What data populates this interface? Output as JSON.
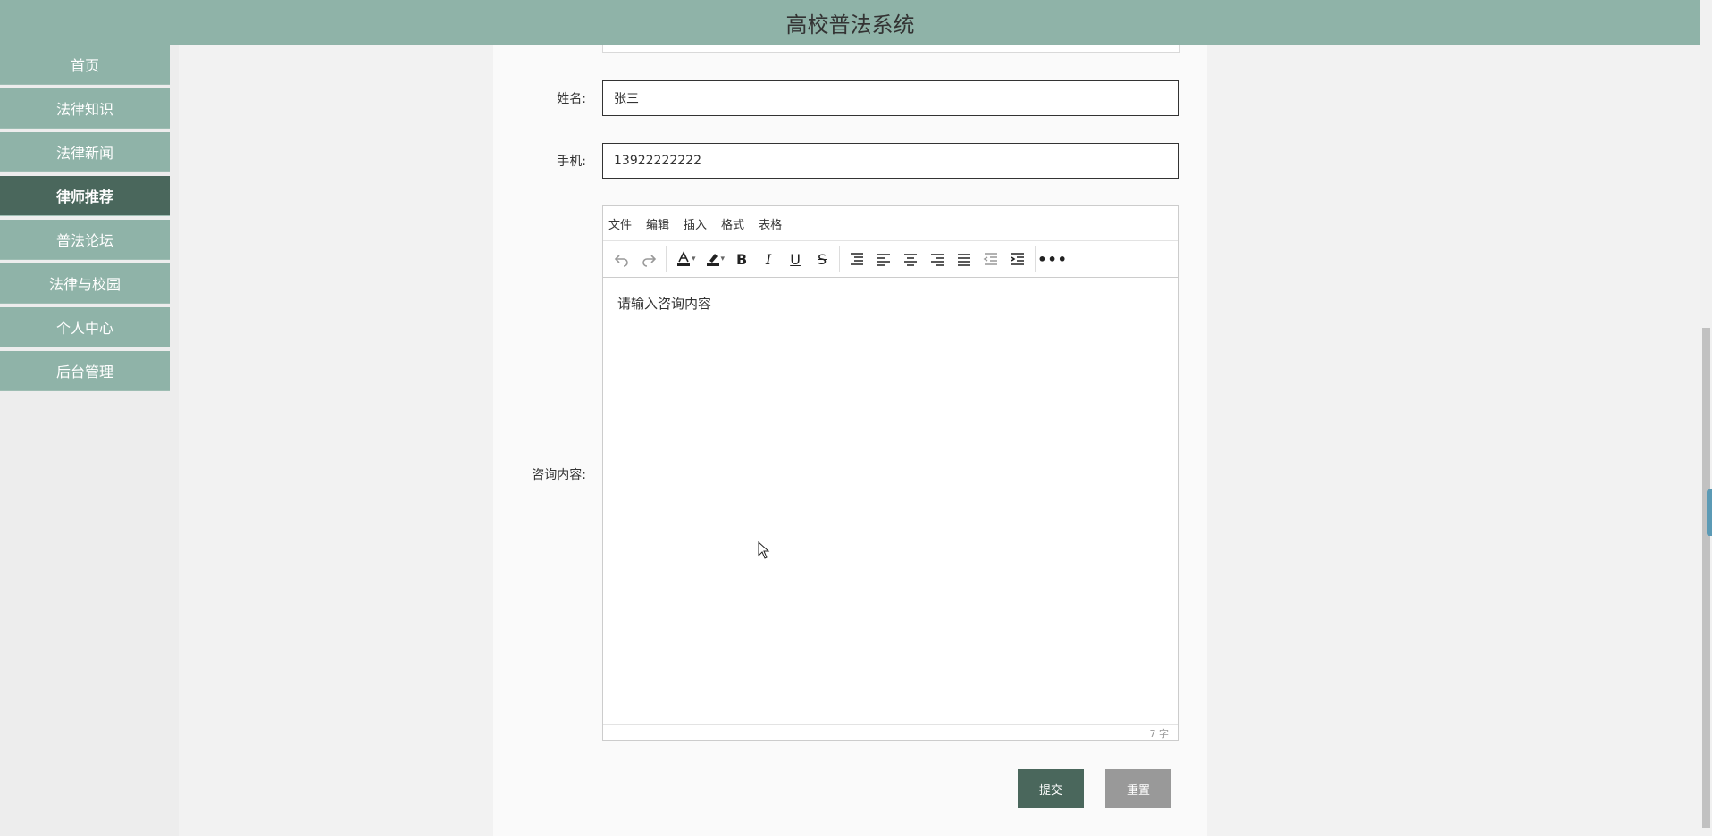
{
  "app": {
    "title": "高校普法系统"
  },
  "sidebar": {
    "items": [
      {
        "label": "首页"
      },
      {
        "label": "法律知识"
      },
      {
        "label": "法律新闻"
      },
      {
        "label": "律师推荐",
        "active": true
      },
      {
        "label": "普法论坛"
      },
      {
        "label": "法律与校园"
      },
      {
        "label": "个人中心"
      },
      {
        "label": "后台管理"
      }
    ]
  },
  "form": {
    "name_label": "姓名:",
    "name_value": "张三",
    "phone_label": "手机:",
    "phone_value": "13922222222",
    "content_label": "咨询内容:"
  },
  "editor": {
    "menu": [
      "文件",
      "编辑",
      "插入",
      "格式",
      "表格"
    ],
    "toolbar_icons": [
      "undo-icon",
      "redo-icon",
      "font-color-icon",
      "highlight-icon",
      "bold-icon",
      "italic-icon",
      "underline-icon",
      "strikethrough-icon",
      "line-height-icon",
      "align-left-icon",
      "align-center-icon",
      "align-right-icon",
      "align-justify-icon",
      "outdent-icon",
      "indent-icon",
      "more-icon"
    ],
    "placeholder": "请输入咨询内容",
    "word_count": "7 字"
  },
  "buttons": {
    "submit": "提交",
    "reset": "重置"
  },
  "colors": {
    "header": "#8fb3a8",
    "active": "#4a675c",
    "reset": "#999999"
  }
}
